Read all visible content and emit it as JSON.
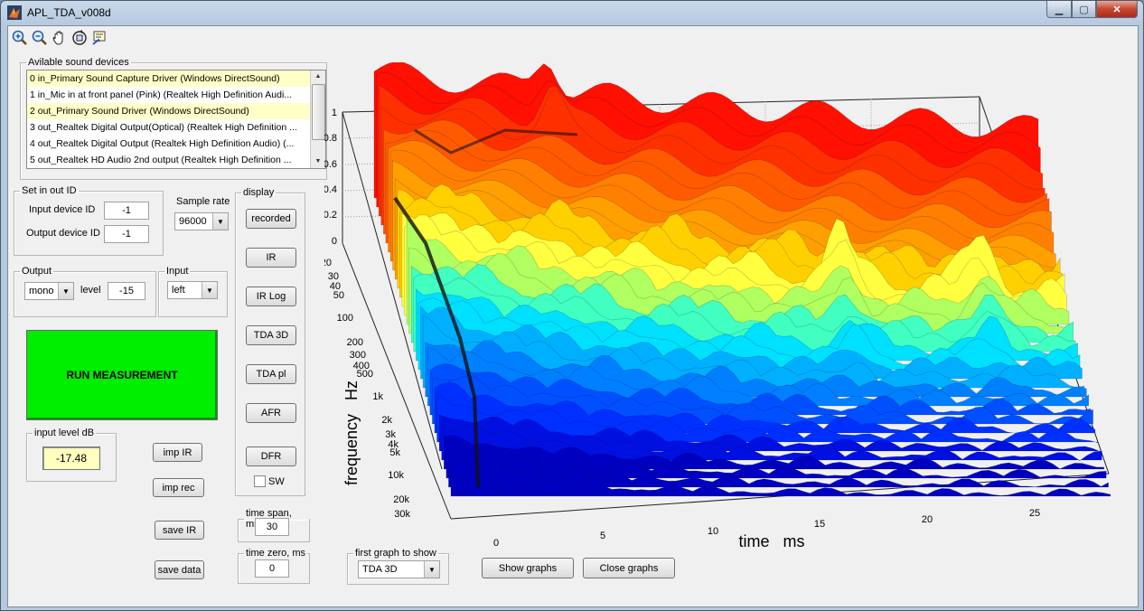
{
  "window": {
    "title": "APL_TDA_v008d"
  },
  "toolbar": {
    "tools": [
      "zoom-in-icon",
      "zoom-out-icon",
      "pan-hand-icon",
      "rotate-3d-icon",
      "data-cursor-icon"
    ]
  },
  "devices": {
    "legend": "Avilable sound devices",
    "items": [
      "0 in_Primary Sound Capture Driver (Windows DirectSound)",
      "1 in_Mic in at front panel (Pink) (Realtek High Definition Audi...",
      "2 out_Primary Sound Driver (Windows DirectSound)",
      "3 out_Realtek Digital Output(Optical) (Realtek High Definition ...",
      "4 out_Realtek Digital Output (Realtek High Definition Audio) (...",
      "5 out_Realtek HD Audio 2nd output (Realtek High Definition ..."
    ]
  },
  "io": {
    "legend": "Set in out ID",
    "input_label": "Input device ID",
    "input_value": "-1",
    "output_label": "Output device ID",
    "output_value": "-1"
  },
  "sample_rate": {
    "label": "Sample rate",
    "value": "96000"
  },
  "output": {
    "legend": "Output",
    "mode": "mono",
    "level_label": "level",
    "level_value": "-15"
  },
  "input": {
    "legend": "Input",
    "channel": "left"
  },
  "run_label": "RUN MEASUREMENT",
  "input_level": {
    "legend": "input level dB",
    "value": "-17.48"
  },
  "side_buttons": {
    "imp_ir": "imp IR",
    "imp_rec": "imp rec",
    "save_ir": "save IR",
    "save_data": "save data"
  },
  "display": {
    "legend": "display",
    "buttons": [
      "recorded",
      "IR",
      "IR Log",
      "TDA 3D",
      "TDA pl",
      "AFR",
      "DFR"
    ],
    "sw_label": "SW"
  },
  "time_span": {
    "legend": "time span, ms",
    "value": "30"
  },
  "time_zero": {
    "legend": "time zero, ms",
    "value": "0"
  },
  "first_graph": {
    "legend": "first graph to show",
    "value": "TDA 3D"
  },
  "show_graphs": "Show graphs",
  "close_graphs": "Close graphs",
  "plot": {
    "xlabel": "time   ms",
    "ylabel": "frequency   Hz",
    "x_ticks": [
      "0",
      "5",
      "10",
      "15",
      "20",
      "25"
    ],
    "y_ticks": [
      "20",
      "30",
      "40",
      "50",
      "100",
      "200",
      "300",
      "400",
      "500",
      "1k",
      "2k",
      "3k",
      "4k",
      "5k",
      "10k",
      "20k",
      "30k"
    ],
    "z_ticks": [
      "0",
      "0.2",
      "0.4",
      "0.6",
      "0.8",
      "1"
    ],
    "colormap": [
      "#00008f",
      "#0000ff",
      "#0080ff",
      "#00ffff",
      "#80ff80",
      "#ffff00",
      "#ff8000",
      "#ff0000",
      "#800000"
    ]
  }
}
